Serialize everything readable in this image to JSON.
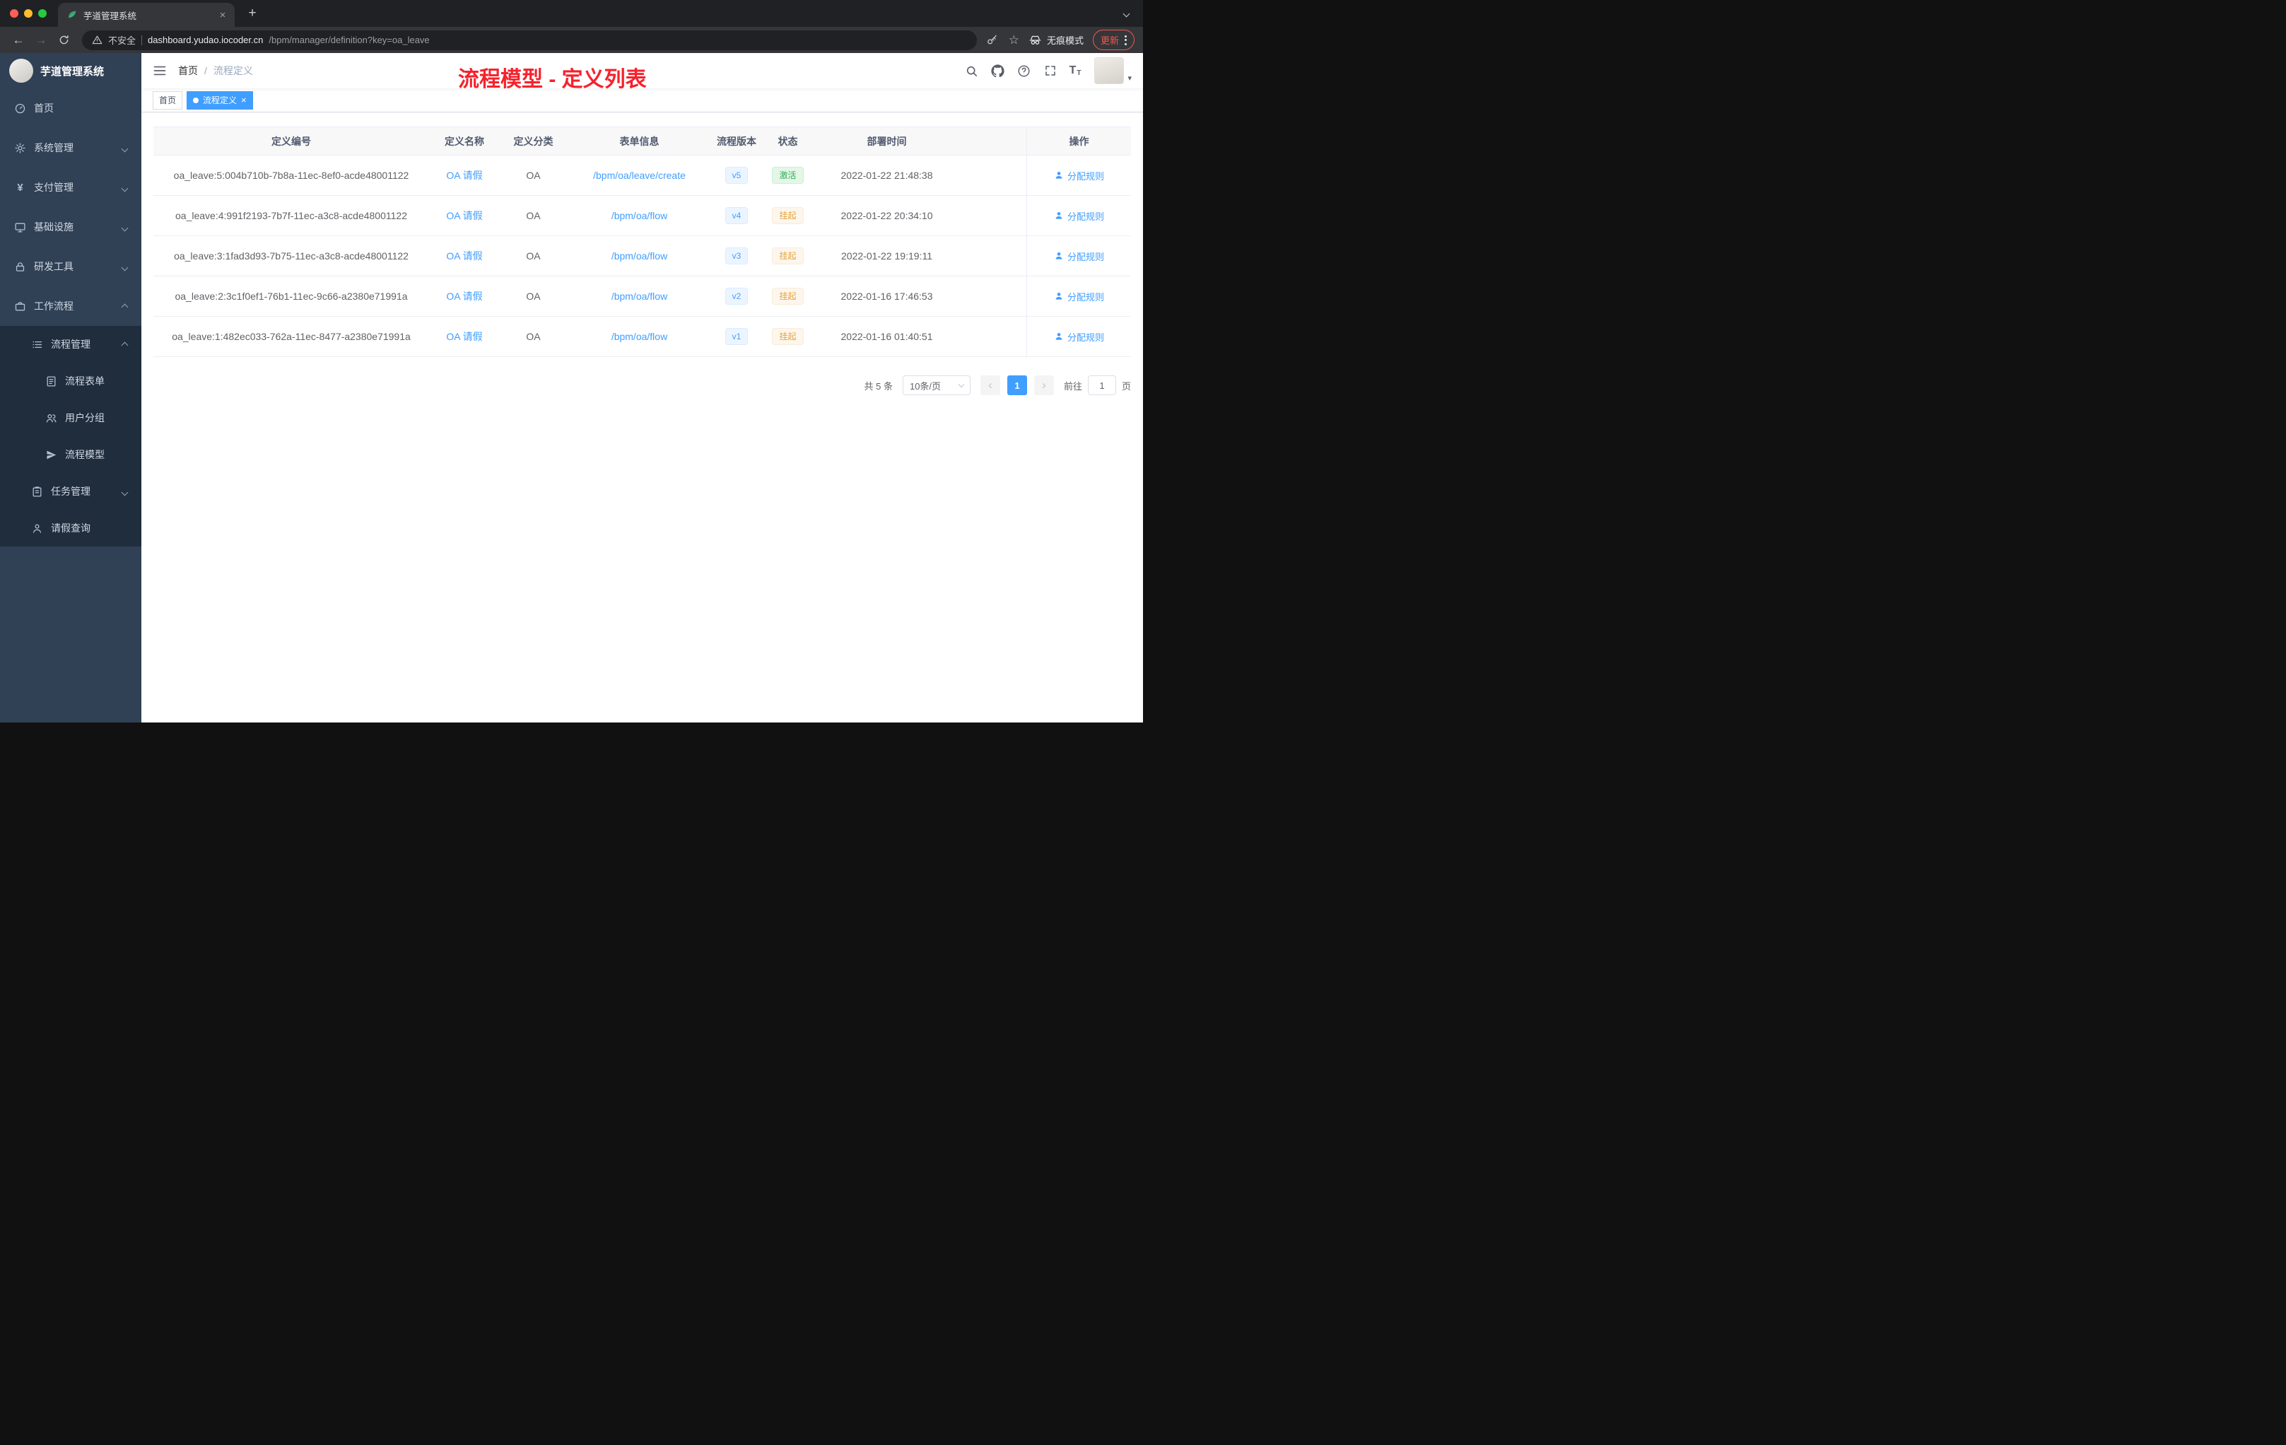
{
  "browser": {
    "tab_title": "芋道管理系统",
    "security_label": "不安全",
    "url_host": "dashboard.yudao.iocoder.cn",
    "url_path": "/bpm/manager/definition?key=oa_leave",
    "incognito_label": "无痕模式",
    "update_label": "更新"
  },
  "sidebar": {
    "brand": "芋道管理系统",
    "items": [
      {
        "label": "首页"
      },
      {
        "label": "系统管理"
      },
      {
        "label": "支付管理"
      },
      {
        "label": "基础设施"
      },
      {
        "label": "研发工具"
      },
      {
        "label": "工作流程"
      },
      {
        "label": "流程管理"
      },
      {
        "label": "流程表单"
      },
      {
        "label": "用户分组"
      },
      {
        "label": "流程模型"
      },
      {
        "label": "任务管理"
      },
      {
        "label": "请假查询"
      }
    ]
  },
  "header": {
    "breadcrumb": {
      "home": "首页",
      "separator": "/",
      "current": "流程定义"
    }
  },
  "annotation": {
    "title": "流程模型 - 定义列表"
  },
  "tags": {
    "items": [
      {
        "label": "首页"
      },
      {
        "label": "流程定义"
      }
    ]
  },
  "table": {
    "columns": [
      "定义编号",
      "定义名称",
      "定义分类",
      "表单信息",
      "流程版本",
      "状态",
      "部署时间",
      "操作"
    ],
    "rows": [
      {
        "id": "oa_leave:5:004b710b-7b8a-11ec-8ef0-acde48001122",
        "name": "OA 请假",
        "category": "OA",
        "form": "/bpm/oa/leave/create",
        "version": "v5",
        "status": "激活",
        "status_type": "active",
        "time": "2022-01-22 21:48:38",
        "action": "分配规则"
      },
      {
        "id": "oa_leave:4:991f2193-7b7f-11ec-a3c8-acde48001122",
        "name": "OA 请假",
        "category": "OA",
        "form": "/bpm/oa/flow",
        "version": "v4",
        "status": "挂起",
        "status_type": "suspended",
        "time": "2022-01-22 20:34:10",
        "action": "分配规则"
      },
      {
        "id": "oa_leave:3:1fad3d93-7b75-11ec-a3c8-acde48001122",
        "name": "OA 请假",
        "category": "OA",
        "form": "/bpm/oa/flow",
        "version": "v3",
        "status": "挂起",
        "status_type": "suspended",
        "time": "2022-01-22 19:19:11",
        "action": "分配规则"
      },
      {
        "id": "oa_leave:2:3c1f0ef1-76b1-11ec-9c66-a2380e71991a",
        "name": "OA 请假",
        "category": "OA",
        "form": "/bpm/oa/flow",
        "version": "v2",
        "status": "挂起",
        "status_type": "suspended",
        "time": "2022-01-16 17:46:53",
        "action": "分配规则"
      },
      {
        "id": "oa_leave:1:482ec033-762a-11ec-8477-a2380e71991a",
        "name": "OA 请假",
        "category": "OA",
        "form": "/bpm/oa/flow",
        "version": "v1",
        "status": "挂起",
        "status_type": "suspended",
        "time": "2022-01-16 01:40:51",
        "action": "分配规则"
      }
    ]
  },
  "pagination": {
    "total": "共 5 条",
    "page_size": "10条/页",
    "page": "1",
    "goto_prefix": "前往",
    "goto_value": "1",
    "goto_suffix": "页"
  },
  "icons": {
    "close": "×",
    "plus": "+",
    "back": "←",
    "forward": "→",
    "star": "☆",
    "prev": "‹",
    "next": "›",
    "caret_down": "▾",
    "yen": "¥",
    "font_large": "T",
    "font_small": "T"
  },
  "theme": {
    "accent": "#409eff",
    "success": "#2fae54",
    "warning": "#e6a23c",
    "annotation_red": "#f5222d",
    "sidebar_bg": "#304156",
    "submenu_bg": "#1f2d3d"
  }
}
